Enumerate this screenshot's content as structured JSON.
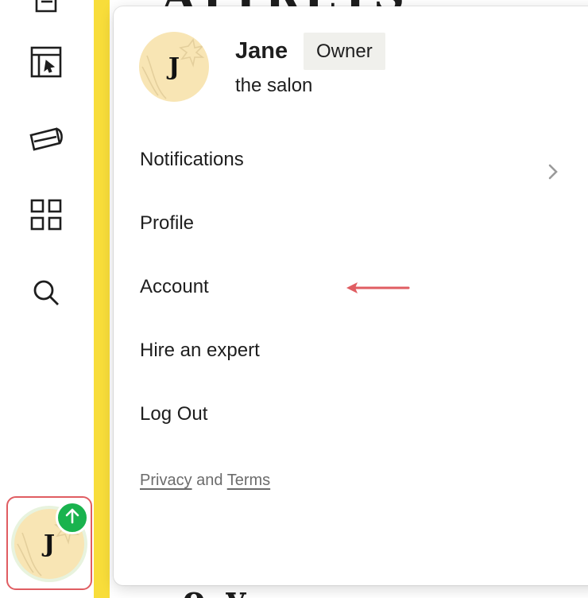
{
  "background": {
    "heading_text": "ATTREYS",
    "bottom_text": "o y"
  },
  "sidebar": {
    "items": [
      {
        "name": "pages",
        "icon": "pages-icon"
      },
      {
        "name": "layout",
        "icon": "layout-cursor-icon"
      },
      {
        "name": "marketing",
        "icon": "megaphone-icon"
      },
      {
        "name": "apps",
        "icon": "grid-icon"
      },
      {
        "name": "search",
        "icon": "search-icon"
      }
    ],
    "accent_color": "#f8dd3a"
  },
  "account_menu": {
    "avatar_initial": "J",
    "user_name": "Jane",
    "role_badge": "Owner",
    "org_name": "the salon",
    "items": [
      {
        "label": "Notifications",
        "has_submenu": true
      },
      {
        "label": "Profile"
      },
      {
        "label": "Account"
      },
      {
        "label": "Hire an expert"
      },
      {
        "label": "Log Out"
      }
    ],
    "footer": {
      "privacy": "Privacy",
      "and": "and",
      "terms": "Terms"
    },
    "annotation_arrow_color": "#e05d62"
  },
  "user_avatar": {
    "initial": "J",
    "badge_color": "#19b34e",
    "badge_icon": "arrow-up-icon",
    "frame_color": "#e05d62"
  }
}
